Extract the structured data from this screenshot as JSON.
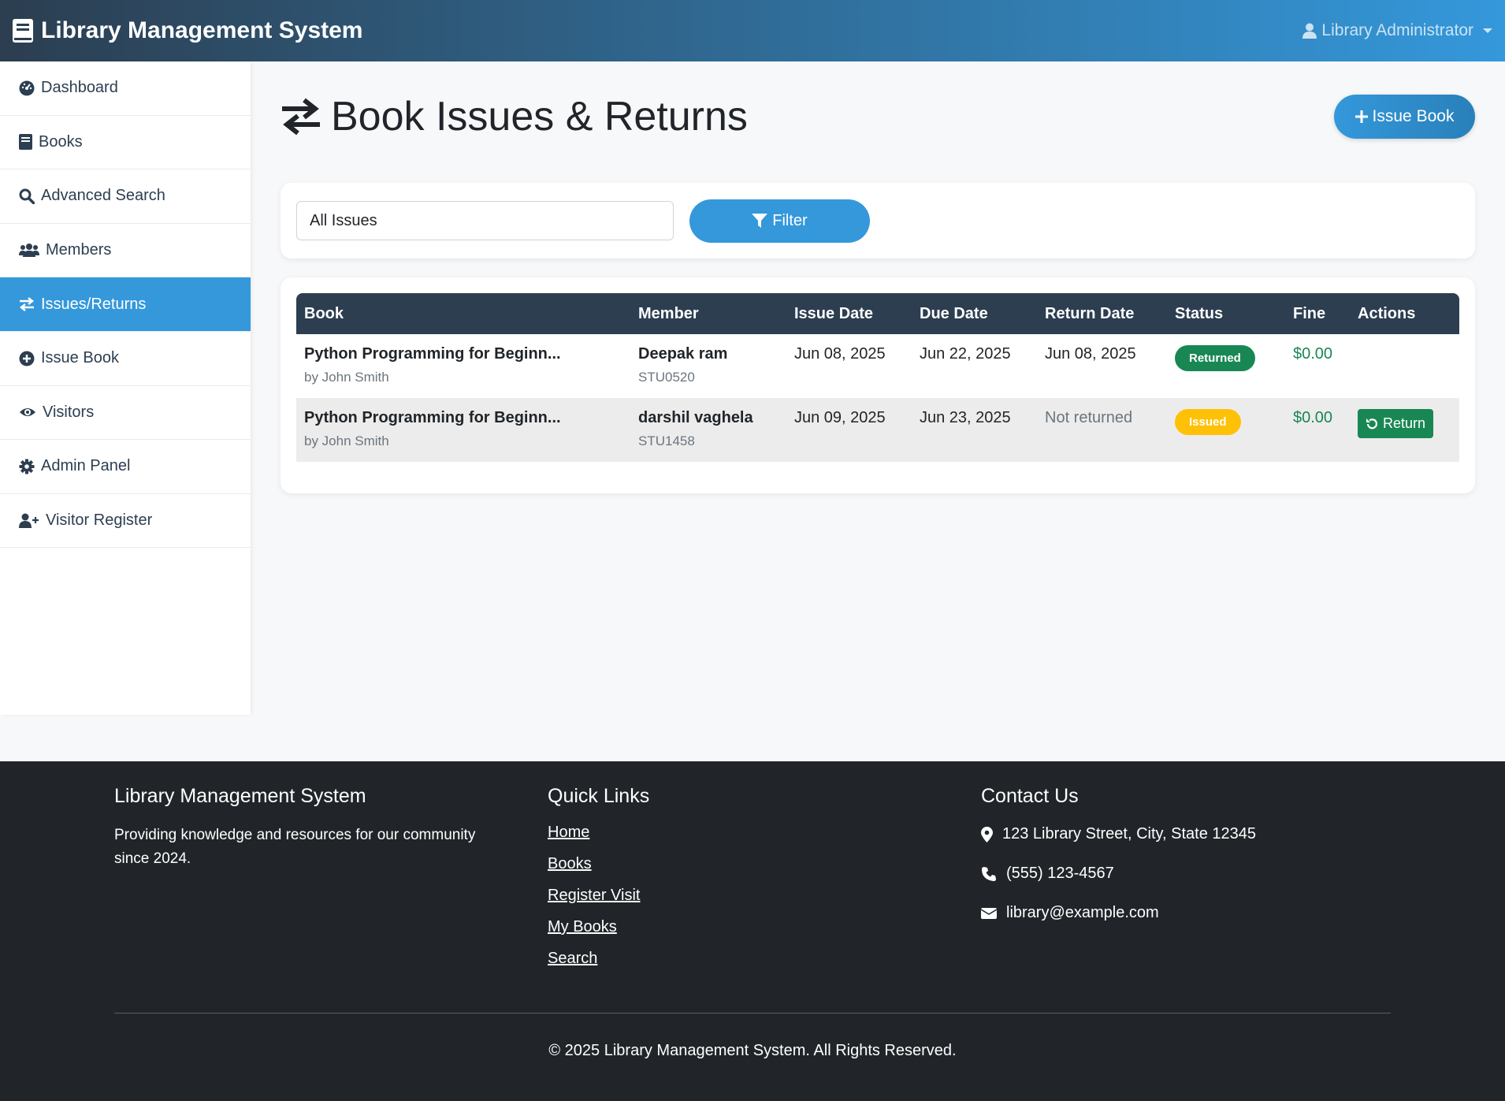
{
  "navbar": {
    "brand": "Library Management System",
    "user": "Library Administrator"
  },
  "sidebar": {
    "items": [
      {
        "label": "Dashboard",
        "icon": "dashboard-icon"
      },
      {
        "label": "Books",
        "icon": "book-icon"
      },
      {
        "label": "Advanced Search",
        "icon": "search-icon"
      },
      {
        "label": "Members",
        "icon": "users-icon"
      },
      {
        "label": "Issues/Returns",
        "icon": "exchange-icon",
        "active": true
      },
      {
        "label": "Issue Book",
        "icon": "plus-circle-icon"
      },
      {
        "label": "Visitors",
        "icon": "eye-icon"
      },
      {
        "label": "Admin Panel",
        "icon": "gear-icon"
      },
      {
        "label": "Visitor Register",
        "icon": "user-plus-icon"
      }
    ]
  },
  "page": {
    "title": "Book Issues & Returns",
    "issue_button": "Issue Book"
  },
  "filter": {
    "selected": "All Issues",
    "button": "Filter"
  },
  "table": {
    "headers": [
      "Book",
      "Member",
      "Issue Date",
      "Due Date",
      "Return Date",
      "Status",
      "Fine",
      "Actions"
    ],
    "rows": [
      {
        "book": "Python Programming for Beginn...",
        "author": "by John Smith",
        "member": "Deepak ram",
        "member_id": "STU0520",
        "issue_date": "Jun 08, 2025",
        "due_date": "Jun 22, 2025",
        "return_date": "Jun 08, 2025",
        "status": "Returned",
        "fine": "$0.00",
        "action": ""
      },
      {
        "book": "Python Programming for Beginn...",
        "author": "by John Smith",
        "member": "darshil vaghela",
        "member_id": "STU1458",
        "issue_date": "Jun 09, 2025",
        "due_date": "Jun 23, 2025",
        "return_date": "Not returned",
        "status": "Issued",
        "fine": "$0.00",
        "action": "Return"
      }
    ]
  },
  "footer": {
    "about_title": "Library Management System",
    "about_text": "Providing knowledge and resources for our community since 2024.",
    "links_title": "Quick Links",
    "links": [
      "Home",
      "Books",
      "Register Visit",
      "My Books",
      "Search"
    ],
    "contact_title": "Contact Us",
    "address": "123 Library Street, City, State 12345",
    "phone": "(555) 123-4567",
    "email": "library@example.com",
    "copyright": "© 2025 Library Management System. All Rights Reserved."
  },
  "colors": {
    "primary": "#3498db",
    "dark": "#2c3e50",
    "success": "#198754",
    "warning": "#ffc107",
    "footer_bg": "#212529"
  }
}
